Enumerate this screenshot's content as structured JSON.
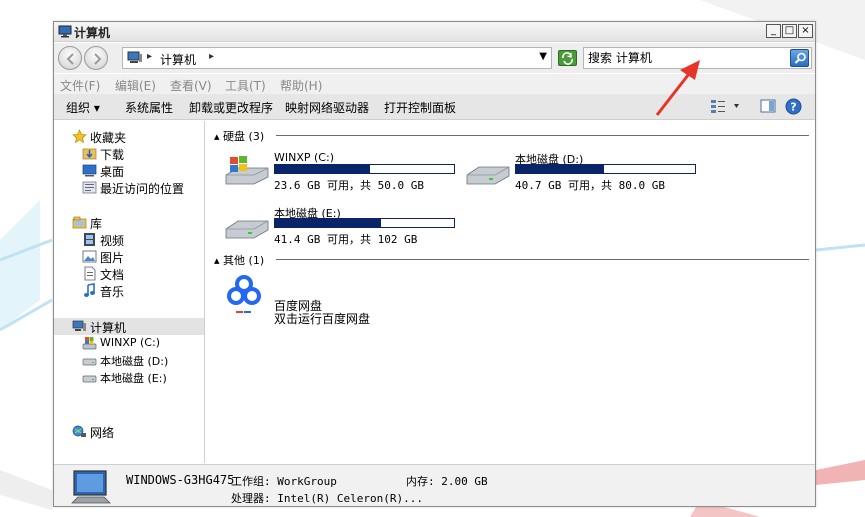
{
  "window": {
    "title": "计算机",
    "controls": {
      "minimize": "_",
      "maximize": "□",
      "close": "×"
    }
  },
  "navbar": {
    "address_location": "计算机",
    "search_placeholder": "搜索 计算机"
  },
  "menu": {
    "items": [
      "文件(F)",
      "编辑(E)",
      "查看(V)",
      "工具(T)",
      "帮助(H)"
    ]
  },
  "toolbar": {
    "organize": "组织 ▾",
    "system_properties": "系统属性",
    "uninstall": "卸载或更改程序",
    "map_drive": "映射网络驱动器",
    "control_panel": "打开控制面板"
  },
  "sidebar": {
    "favorites": "收藏夹",
    "downloads": "下载",
    "desktop": "桌面",
    "recent": "最近访问的位置",
    "libraries": "库",
    "videos": "视频",
    "pictures": "图片",
    "documents": "文档",
    "music": "音乐",
    "computer": "计算机",
    "drive_c": "WINXP (C:)",
    "drive_d": "本地磁盘 (D:)",
    "drive_e": "本地磁盘 (E:)",
    "network": "网络"
  },
  "content": {
    "hard_disks_header": "硬盘 (3)",
    "other_header": "其他 (1)",
    "drives": [
      {
        "name": "WINXP (C:)",
        "free_text": "23.6 GB 可用，共 50.0 GB",
        "used_fraction": 0.528
      },
      {
        "name": "本地磁盘 (D:)",
        "free_text": "40.7 GB 可用，共 80.0 GB",
        "used_fraction": 0.491
      },
      {
        "name": "本地磁盘 (E:)",
        "free_text": "41.4 GB 可用，共 102 GB",
        "used_fraction": 0.594
      }
    ],
    "app": {
      "name": "百度网盘",
      "desc": "双击运行百度网盘"
    }
  },
  "details": {
    "computer_name": "WINDOWS-G3HG475",
    "workgroup": "工作组: WorkGroup",
    "memory": "内存: 2.00 GB",
    "processor": "处理器: Intel(R) Celeron(R)..."
  },
  "colors": {
    "disk_bar": "#0a246a",
    "annotation_arrow": "#e8332a"
  }
}
